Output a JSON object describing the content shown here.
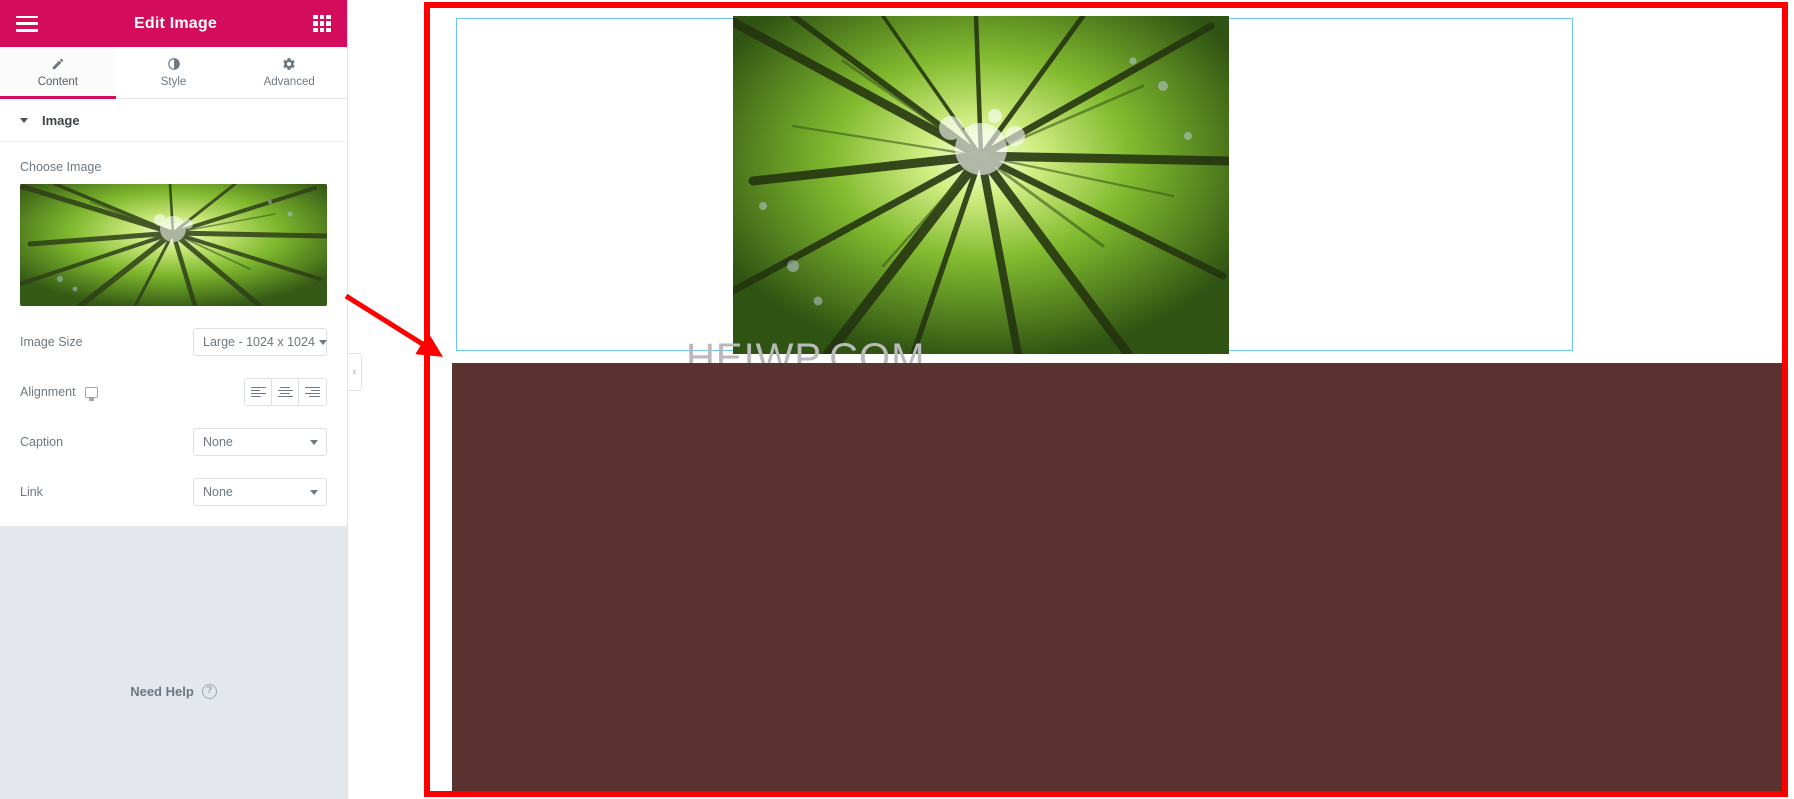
{
  "panel": {
    "header": {
      "title": "Edit Image",
      "menu_icon": "hamburger-icon",
      "apps_icon": "grid-apps-icon",
      "bg_color": "#d30c5c"
    },
    "tabs": [
      {
        "label": "Content",
        "icon": "pencil-icon",
        "active": true
      },
      {
        "label": "Style",
        "icon": "contrast-icon",
        "active": false
      },
      {
        "label": "Advanced",
        "icon": "gear-icon",
        "active": false
      }
    ],
    "section": {
      "title": "Image",
      "collapse_icon": "caret-down-icon"
    },
    "fields": {
      "choose_image_label": "Choose Image",
      "image_size": {
        "label": "Image Size",
        "value": "Large - 1024 x 1024"
      },
      "alignment": {
        "label": "Alignment",
        "device_icon": "desktop-monitor-icon",
        "options": [
          "align-left",
          "align-center",
          "align-right"
        ]
      },
      "caption": {
        "label": "Caption",
        "value": "None"
      },
      "link": {
        "label": "Link",
        "value": "None"
      }
    },
    "footer": {
      "need_help_label": "Need Help",
      "help_icon": "question-circle-icon"
    },
    "collapse_handle_icon": "chevron-left-icon"
  },
  "canvas": {
    "watermark": "HEIWP.COM",
    "selection_outline_color": "#6ec6f0",
    "annotation_color": "#fe0000",
    "block_color": "#5a322f"
  }
}
